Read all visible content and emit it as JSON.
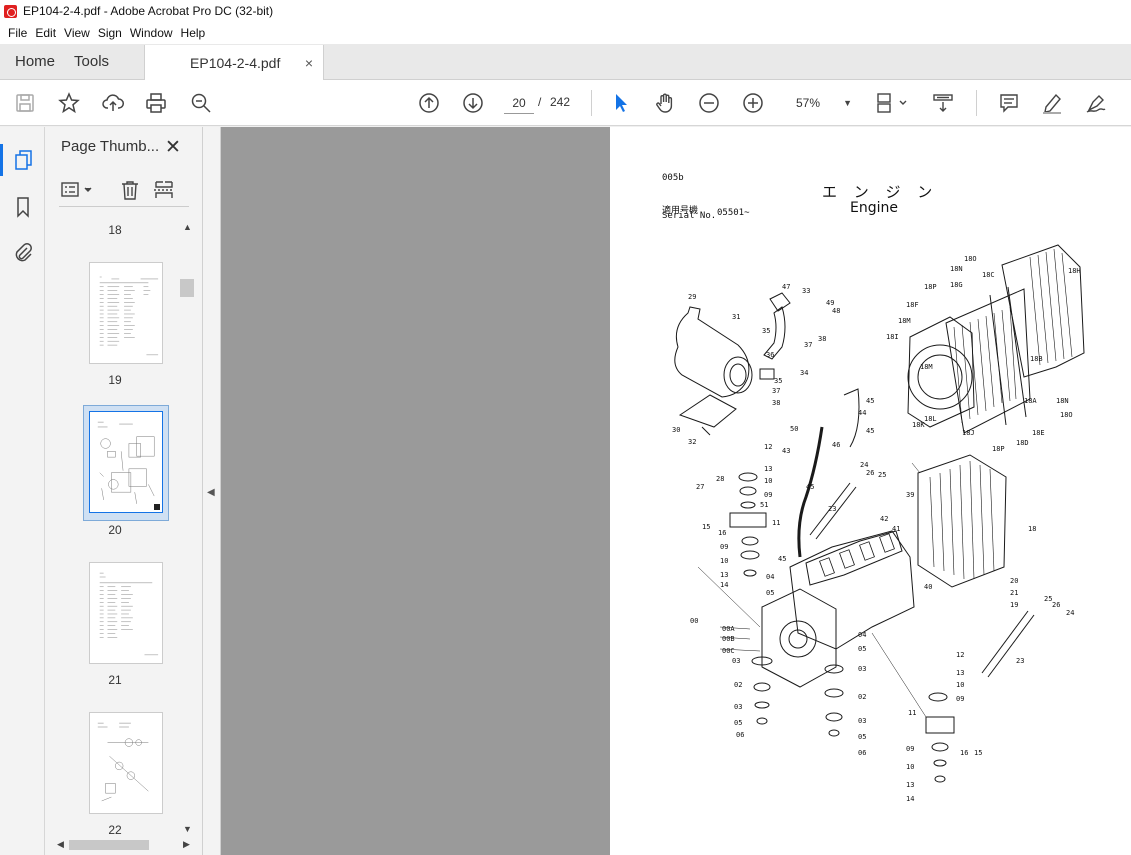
{
  "window": {
    "title": "EP104-2-4.pdf - Adobe Acrobat Pro DC (32-bit)"
  },
  "menu": [
    "File",
    "Edit",
    "View",
    "Sign",
    "Window",
    "Help"
  ],
  "tabs": {
    "home": "Home",
    "tools": "Tools",
    "document": "EP104-2-4.pdf",
    "close": "×"
  },
  "toolbar": {
    "current_page": "20",
    "page_separator": "/",
    "total_pages": "242",
    "zoom": "57%"
  },
  "panel": {
    "title": "Page Thumb...",
    "thumbnails": [
      {
        "label": "18"
      },
      {
        "label": "19"
      },
      {
        "label": "20",
        "selected": true
      },
      {
        "label": "21"
      },
      {
        "label": "22"
      }
    ]
  },
  "document_page": {
    "code": "005b",
    "title_jp": "エ ン ジ ン",
    "title_en": "Engine",
    "serial_label_jp": "適用号機",
    "serial_label_en": "Serial No.",
    "serial_value": "05501~",
    "part_labels": [
      "29",
      "31",
      "47",
      "33",
      "49",
      "48",
      "35",
      "36",
      "37",
      "38",
      "34",
      "35",
      "37",
      "38",
      "30",
      "32",
      "45",
      "44",
      "45",
      "46",
      "50",
      "43",
      "12",
      "28",
      "13",
      "27",
      "10",
      "09",
      "51",
      "23",
      "45",
      "15",
      "16",
      "11",
      "09",
      "10",
      "13",
      "14",
      "45",
      "04",
      "05",
      "24",
      "26",
      "25",
      "39",
      "42",
      "41",
      "40",
      "18",
      "20",
      "21",
      "19",
      "25",
      "26",
      "24",
      "23",
      "00",
      "00A",
      "00B",
      "00C",
      "03",
      "02",
      "03",
      "05",
      "06",
      "04",
      "05",
      "03",
      "02",
      "03",
      "05",
      "06",
      "12",
      "13",
      "10",
      "09",
      "11",
      "16",
      "15",
      "09",
      "10",
      "13",
      "14",
      "18O",
      "18N",
      "18H",
      "18C",
      "18P",
      "18G",
      "18F",
      "18M",
      "18I",
      "18M",
      "18B",
      "18N",
      "18A",
      "18O",
      "18L",
      "18K",
      "18J",
      "18P",
      "18D",
      "18E"
    ]
  }
}
